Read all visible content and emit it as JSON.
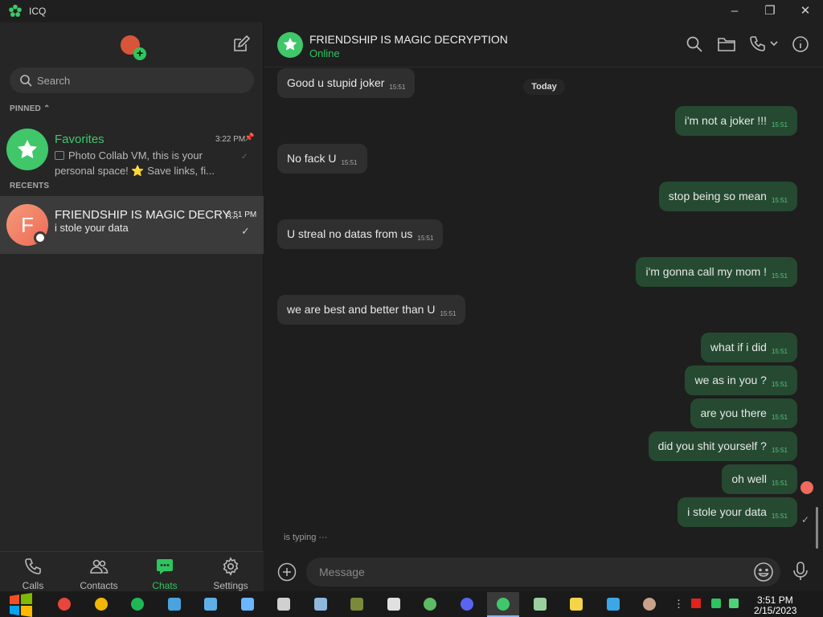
{
  "window": {
    "title": "ICQ",
    "minimize": "–",
    "restore": "❐",
    "close": "✕"
  },
  "sidebar": {
    "search_placeholder": "Search",
    "pinned_label": "PINNED",
    "recents_label": "RECENTS",
    "pinned": [
      {
        "name": "Favorites",
        "time": "3:22 PM",
        "preview_line1": "Photo Collab VM, this is your",
        "preview_line2": "personal space! ⭐ Save links, fi...",
        "avatar_color": "#3fc76a"
      }
    ],
    "recents": [
      {
        "name": "FRIENDSHIP IS MAGIC DECRY...",
        "time": "3:51 PM",
        "preview": "i stole your data",
        "avatar_letter": "F",
        "avatar_color": "#f07f66",
        "status": "✓"
      }
    ],
    "nav": [
      {
        "label": "Calls",
        "icon": "phone-icon"
      },
      {
        "label": "Contacts",
        "icon": "contacts-icon"
      },
      {
        "label": "Chats",
        "icon": "chats-icon",
        "active": true
      },
      {
        "label": "Settings",
        "icon": "gear-icon"
      }
    ]
  },
  "chat": {
    "title": "FRIENDSHIP IS MAGIC DECRYPTION",
    "status": "Online",
    "date_separator": "Today",
    "messages": [
      {
        "dir": "in",
        "text": "Good u stupid joker",
        "time": "15:51"
      },
      {
        "dir": "out",
        "text": "i'm not a joker !!!",
        "time": "15:51"
      },
      {
        "dir": "in",
        "text": "No fack U",
        "time": "15:51"
      },
      {
        "dir": "out",
        "text": "stop being so mean",
        "time": "15:51"
      },
      {
        "dir": "in",
        "text": "U streal no datas from us",
        "time": "15:51"
      },
      {
        "dir": "out",
        "text": "i'm gonna call my mom !",
        "time": "15:51"
      },
      {
        "dir": "in",
        "text": "we are best and better than U",
        "time": "15:51"
      },
      {
        "dir": "out",
        "text": "what if i did",
        "time": "15:51"
      },
      {
        "dir": "out",
        "text": "we as in you ?",
        "time": "15:51"
      },
      {
        "dir": "out",
        "text": "are you there",
        "time": "15:51"
      },
      {
        "dir": "out",
        "text": "did you shit yourself ?",
        "time": "15:51"
      },
      {
        "dir": "out",
        "text": "oh well",
        "time": "15:51"
      },
      {
        "dir": "out",
        "text": "i stole your data",
        "time": "15:51"
      }
    ],
    "typing": "is typing ···",
    "message_placeholder": "Message",
    "last_status": "✓"
  },
  "taskbar": {
    "time": "3:51 PM",
    "date": "2/15/2023",
    "apps": [
      {
        "name": "chrome-icon",
        "color": "#e8453c"
      },
      {
        "name": "chrome-icon",
        "color": "#f2b705"
      },
      {
        "name": "spotify-icon",
        "color": "#1db954"
      },
      {
        "name": "people-icon",
        "color": "#4aa3df"
      },
      {
        "name": "people-icon",
        "color": "#5fb0e8"
      },
      {
        "name": "tool-icon",
        "color": "#6ab7ff"
      },
      {
        "name": "installer-icon",
        "color": "#d0d0d0"
      },
      {
        "name": "window-icon",
        "color": "#8fb8de"
      },
      {
        "name": "game-icon",
        "color": "#7a8a3a"
      },
      {
        "name": "java-icon",
        "color": "#e0e0e0"
      },
      {
        "name": "face-icon",
        "color": "#5dbb63"
      },
      {
        "name": "discord-icon",
        "color": "#5865f2"
      },
      {
        "name": "icq-icon",
        "color": "#3fc76a"
      },
      {
        "name": "monitor-icon",
        "color": "#9ad0a0"
      },
      {
        "name": "notes-icon",
        "color": "#f5d547"
      },
      {
        "name": "vscode-icon",
        "color": "#3ba7e8"
      },
      {
        "name": "avatar-icon",
        "color": "#c9a28a"
      }
    ]
  }
}
